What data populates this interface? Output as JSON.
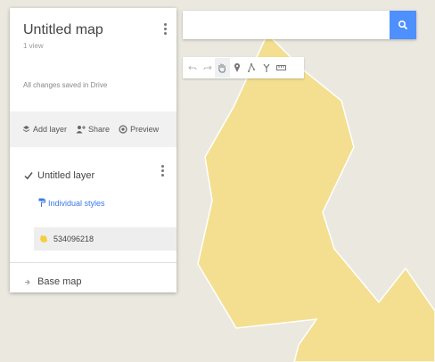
{
  "map": {
    "land_color": "#ebe8df",
    "shape_fill": "#f3df8f",
    "shape_stroke": "#ffffff"
  },
  "search": {
    "value": "",
    "placeholder": "",
    "icon": "search-icon",
    "button_color": "#4d90fe"
  },
  "toolbar": {
    "tools": [
      {
        "name": "undo-icon"
      },
      {
        "name": "redo-icon"
      },
      {
        "name": "hand-pan-icon",
        "active": true
      },
      {
        "name": "add-marker-icon"
      },
      {
        "name": "draw-line-icon"
      },
      {
        "name": "add-directions-icon"
      },
      {
        "name": "measure-ruler-icon"
      }
    ]
  },
  "panel": {
    "title": "Untitled map",
    "views": "1 view",
    "saved": "All changes saved in Drive",
    "actions": {
      "add_layer": "Add layer",
      "share": "Share",
      "preview": "Preview"
    },
    "layer": {
      "name": "Untitled layer",
      "checked": true,
      "styles": "Individual styles",
      "feature": "534096218",
      "feature_color": "#f3cf3c"
    },
    "basemap": "Base map"
  }
}
